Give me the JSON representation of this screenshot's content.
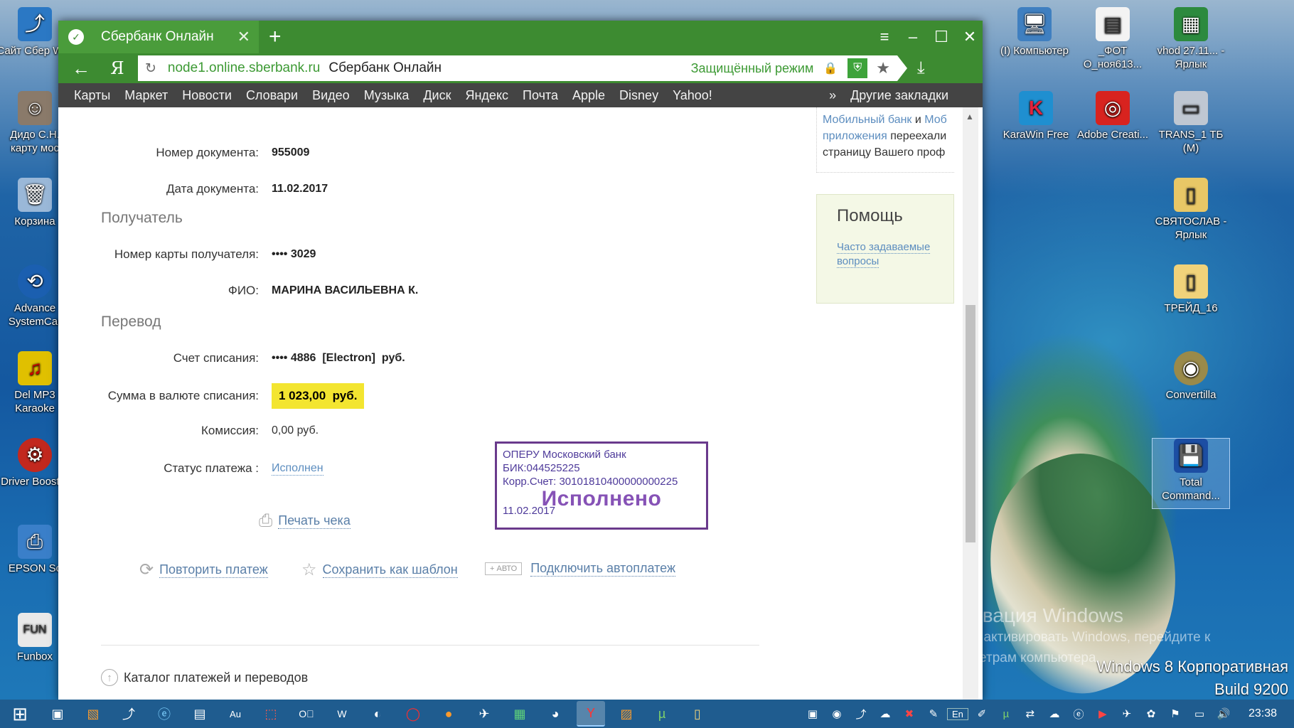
{
  "desktop": {
    "left_icons": [
      {
        "label": "Сайт Сбер WPI",
        "icon": "shortcut-icon"
      },
      {
        "label": "Дидо С.Н. карту мос",
        "icon": "photo-icon"
      },
      {
        "label": "Корзина",
        "icon": "recycle-bin-icon"
      },
      {
        "label": "Advance SystemCar",
        "icon": "advanced-systemcare-icon"
      },
      {
        "label": "Del MP3 Karaoke",
        "icon": "karaoke-icon"
      },
      {
        "label": "Driver Booster",
        "icon": "driver-booster-icon"
      },
      {
        "label": "EPSON Sc",
        "icon": "epson-icon"
      },
      {
        "label": "Funbox",
        "icon": "funbox-icon"
      }
    ],
    "right_icons": [
      {
        "label": "(I)",
        "icon": "shortcut-icon"
      },
      {
        "label": "Компьютер",
        "icon": "computer-icon"
      },
      {
        "label": "_ФОТ О_ноя613...",
        "icon": "document-icon"
      },
      {
        "label": "vhod 27.11... - Ярлык",
        "icon": "spreadsheet-icon"
      },
      {
        "label": "KaraWin Free",
        "icon": "karawin-icon"
      },
      {
        "label": "Adobe Creati...",
        "icon": "adobe-icon"
      },
      {
        "label": "TRANS_1 ТБ (M)",
        "icon": "drive-icon"
      },
      {
        "label": "СВЯТОСЛАВ - Ярлык",
        "icon": "folder-shortcut-icon"
      },
      {
        "label": "ТРЕЙД_16",
        "icon": "folder-icon"
      },
      {
        "label": "Convertilla",
        "icon": "convertilla-icon"
      },
      {
        "label": "Total Command...",
        "icon": "total-commander-icon"
      }
    ]
  },
  "browser": {
    "tab_title": "Сбербанк Онлайн",
    "address": {
      "host": "node1.online.sberbank.ru",
      "title": "Сбербанк Онлайн",
      "secure_mode": "Защищённый режим"
    },
    "bookmarks": [
      "Карты",
      "Маркет",
      "Новости",
      "Словари",
      "Видео",
      "Музыка",
      "Диск",
      "Яндекс",
      "Почта",
      "Apple",
      "Disney",
      "Yahoo!"
    ],
    "other_bookmarks": "Другие закладки"
  },
  "receipt": {
    "doc_number_label": "Номер документа:",
    "doc_number": "955009",
    "doc_date_label": "Дата документа:",
    "doc_date": "11.02.2017",
    "recipient_section": "Получатель",
    "card_label": "Номер карты получателя:",
    "card_value": "•••• 3029",
    "name_label": "ФИО:",
    "name_value": "МАРИНА ВАСИЛЬЕВНА К.",
    "transfer_section": "Перевод",
    "account_label": "Счет списания:",
    "account_value": "•••• 4886  [Electron]  руб.",
    "amount_label": "Сумма в валюте списания:",
    "amount_value": "1 023,00  руб.",
    "fee_label": "Комиссия:",
    "fee_value": "0,00 руб.",
    "status_label": "Статус платежа :",
    "status_value": "Исполнен",
    "print_link": "Печать чека",
    "repeat_link": "Повторить платеж",
    "save_template_link": "Сохранить как шаблон",
    "auto_badge": "+ АВТО",
    "autopay_link": "Подключить автоплатеж",
    "catalog_link": "Каталог платежей и переводов"
  },
  "stamp": {
    "line1": "ОПЕРУ Московский банк",
    "line2": "БИК:044525225",
    "line3": "Корр.Счет: 30101810400000000225",
    "big": "Исполнено",
    "date": "11.02.2017"
  },
  "sidebar": {
    "mobile_text1": "Мобильный банк",
    "mobile_and": " и ",
    "mobile_text2": "Моб",
    "mobile_text3": "приложения",
    "mobile_text4": " переехали",
    "mobile_text5": "страницу Вашего проф",
    "help_title": "Помощь",
    "help_link": "Часто задаваемые вопросы"
  },
  "watermark": {
    "title": "Активация Windows",
    "line1": "Чтобы активировать Windows, перейдите к",
    "line2": "параметрам компьютера.",
    "edition": "Windows 8 Корпоративная",
    "build": "Build 9200"
  },
  "taskbar": {
    "lang": "En",
    "time": "23:38"
  }
}
